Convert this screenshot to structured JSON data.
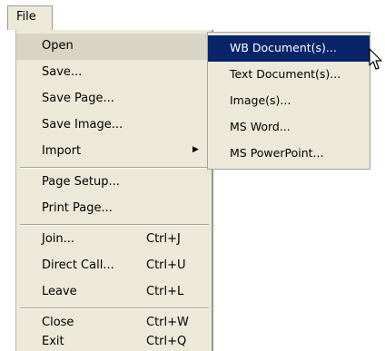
{
  "menubar": {
    "file_label": "File"
  },
  "file_menu": {
    "items": [
      {
        "label": "Open",
        "shortcut": "",
        "submenu": true
      },
      {
        "label": "Save...",
        "shortcut": ""
      },
      {
        "label": "Save Page...",
        "shortcut": ""
      },
      {
        "label": "Save Image...",
        "shortcut": ""
      },
      {
        "label": "Import",
        "shortcut": "",
        "submenu": true
      },
      {
        "label": "Page Setup...",
        "shortcut": ""
      },
      {
        "label": "Print Page...",
        "shortcut": ""
      },
      {
        "label": "Join...",
        "shortcut": "Ctrl+J"
      },
      {
        "label": "Direct Call...",
        "shortcut": "Ctrl+U"
      },
      {
        "label": "Leave",
        "shortcut": "Ctrl+L"
      },
      {
        "label": "Close",
        "shortcut": "Ctrl+W"
      },
      {
        "label": "Exit",
        "shortcut": "Ctrl+Q"
      }
    ]
  },
  "open_submenu": {
    "items": [
      {
        "label": "WB Document(s)..."
      },
      {
        "label": "Text Document(s)..."
      },
      {
        "label": "Image(s)..."
      },
      {
        "label": "MS Word..."
      },
      {
        "label": "MS PowerPoint..."
      }
    ]
  },
  "colors": {
    "menu_background": "#ece9d8",
    "highlight": "#0a246a",
    "highlight_text": "#ffffff"
  },
  "icons": {
    "submenu_arrow": "triangle-right-icon",
    "cursor": "arrow-cursor-icon"
  }
}
